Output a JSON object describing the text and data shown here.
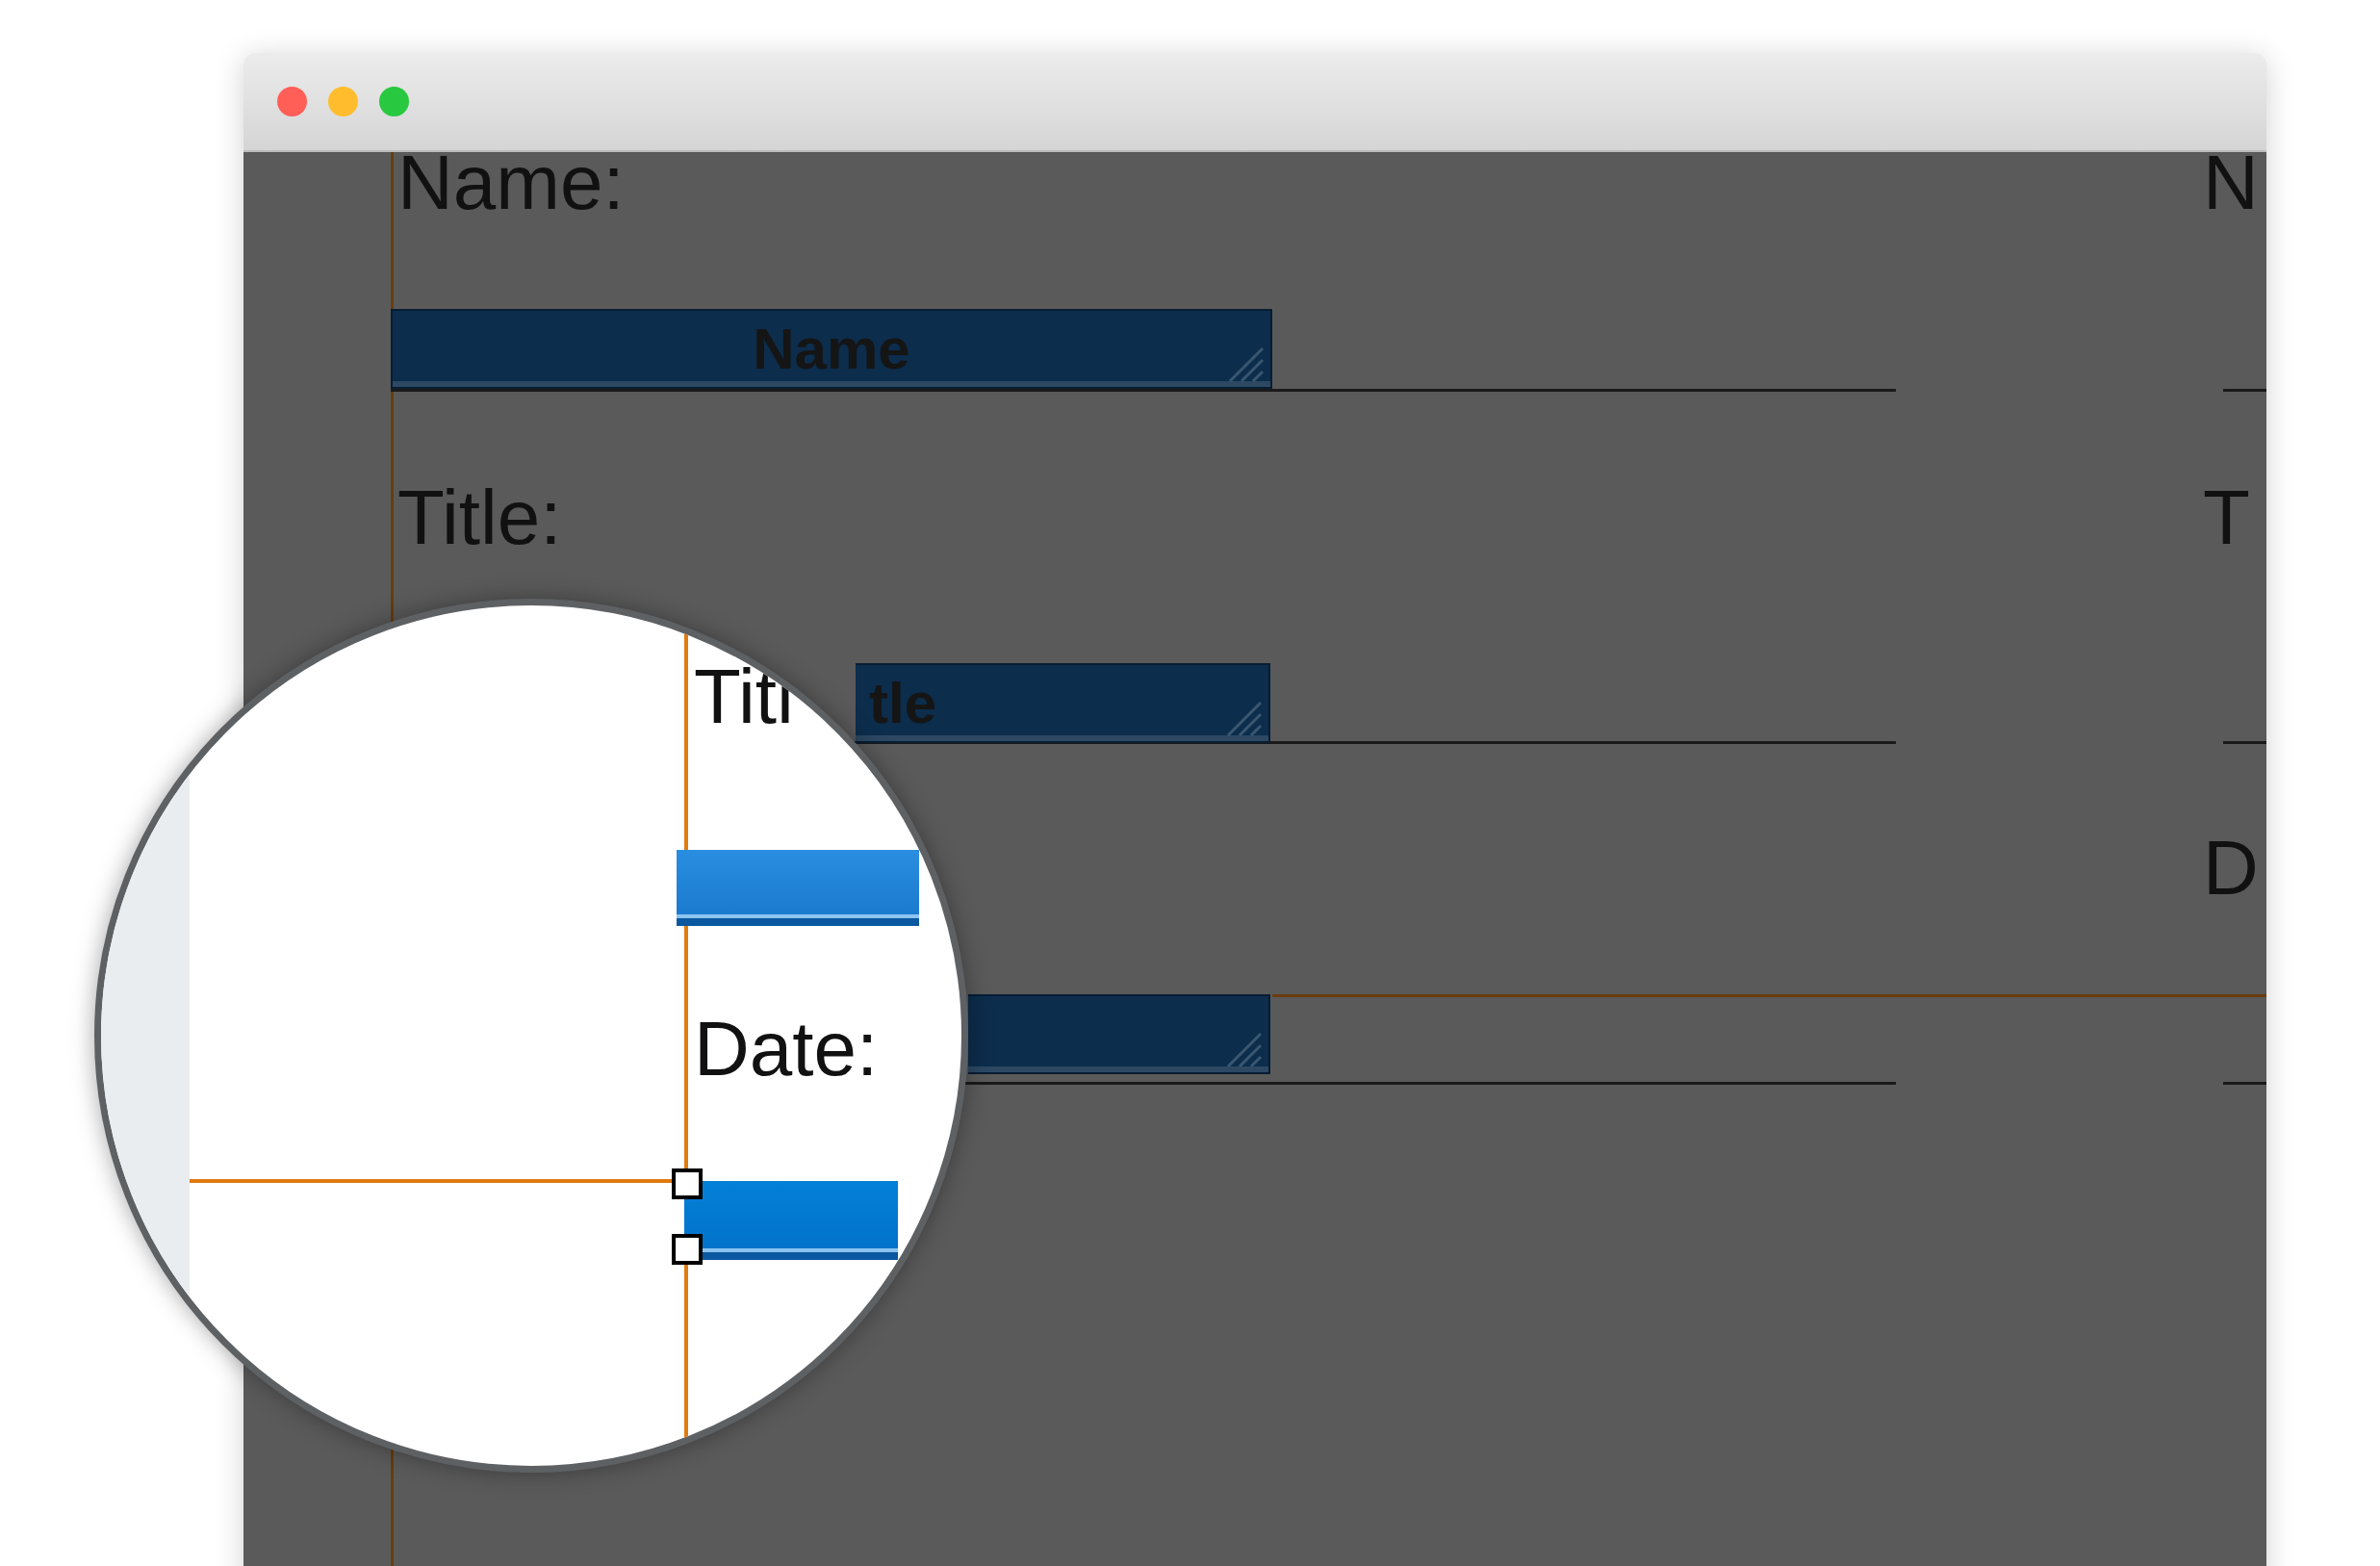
{
  "window": {
    "controls": [
      {
        "color": "#ff5f57"
      },
      {
        "color": "#ffbd2e"
      },
      {
        "color": "#28c840"
      }
    ]
  },
  "layout": {
    "labels": [
      "Name:",
      "Title:"
    ],
    "fields": [
      {
        "kind": "field",
        "label": "Name"
      },
      {
        "kind": "field",
        "label": "tle"
      },
      {
        "kind": "field"
      }
    ],
    "right_labels": [
      "N",
      "T",
      "D"
    ]
  },
  "magnifier": {
    "labels": [
      "Titl",
      "Date:"
    ],
    "fields": [
      {
        "selected": false
      },
      {
        "selected": true
      }
    ]
  }
}
